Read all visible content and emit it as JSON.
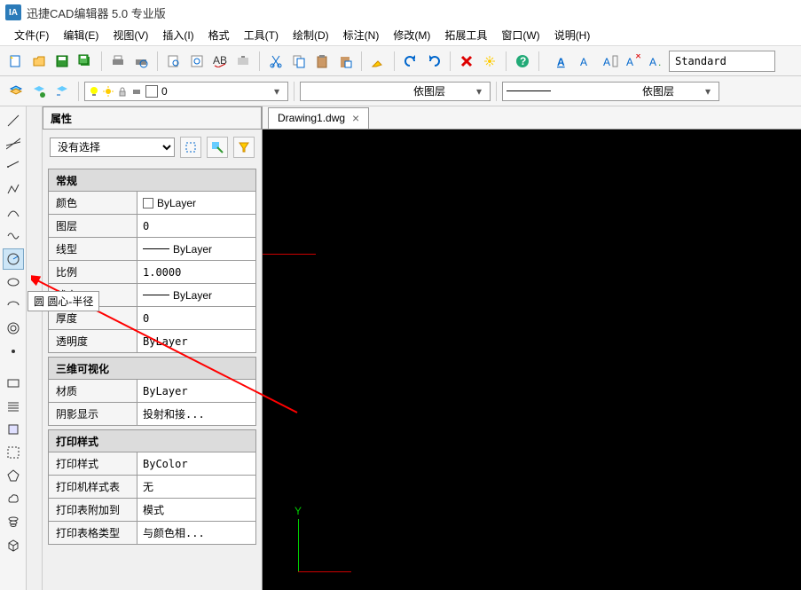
{
  "app": {
    "icon_text": "IA",
    "title": "迅捷CAD编辑器 5.0 专业版"
  },
  "menu": [
    "文件(F)",
    "编辑(E)",
    "视图(V)",
    "插入(I)",
    "格式",
    "工具(T)",
    "绘制(D)",
    "标注(N)",
    "修改(M)",
    "拓展工具",
    "窗口(W)",
    "说明(H)"
  ],
  "toolbar2": {
    "layer_name": "0",
    "bylayer1": "依图层",
    "bylayer2": "依图层"
  },
  "text_style": "Standard",
  "tab_name": "Drawing1.dwg",
  "properties": {
    "panel_title": "属性",
    "selection": "没有选择",
    "groups": {
      "general": {
        "title": "常规",
        "rows": {
          "color": {
            "label": "颜色",
            "value": "ByLayer"
          },
          "layer": {
            "label": "图层",
            "value": "0"
          },
          "linetype": {
            "label": "线型",
            "value": "ByLayer"
          },
          "ltscale": {
            "label": "比例",
            "value": "1.0000"
          },
          "lineweight": {
            "label": "线宽",
            "value": "ByLayer"
          },
          "thickness": {
            "label": "厚度",
            "value": "0"
          },
          "transparency": {
            "label": "透明度",
            "value": "ByLayer"
          }
        }
      },
      "visual3d": {
        "title": "三维可视化",
        "rows": {
          "material": {
            "label": "材质",
            "value": "ByLayer"
          },
          "shadow": {
            "label": "阴影显示",
            "value": "投射和接..."
          }
        }
      },
      "plot": {
        "title": "打印样式",
        "rows": {
          "plotstyle": {
            "label": "打印样式",
            "value": "ByColor"
          },
          "plottable": {
            "label": "打印机样式表",
            "value": "无"
          },
          "plotattach": {
            "label": "打印表附加到",
            "value": "模式"
          },
          "plottype": {
            "label": "打印表格类型",
            "value": "与颜色相..."
          }
        }
      }
    }
  },
  "tooltip": "圆 圆心-半径"
}
